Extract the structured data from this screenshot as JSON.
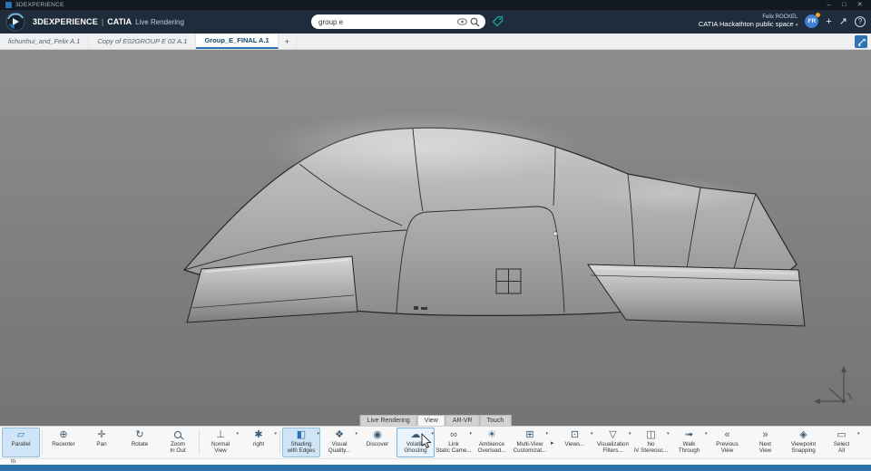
{
  "titlebar": {
    "app_label": "3DEXPERIENCE",
    "minimize": "–",
    "maximize": "□",
    "close": "✕"
  },
  "header": {
    "brand": "3DEXPERIENCE",
    "divider": "|",
    "app": "CATIA",
    "module": "Live Rendering",
    "search_value": "group e",
    "user_name": "Felix ROCKEL",
    "workspace": "CATIA Hackathton public space",
    "workspace_caret": "▾",
    "avatar": "FR",
    "add_icon": "+",
    "share_icon": "↗",
    "help_icon": "?"
  },
  "tabbar": {
    "tabs": [
      {
        "label": "lichunhui_and_Felix A.1"
      },
      {
        "label": "Copy of E02GROUP E 02 A.1"
      },
      {
        "label": "Group_E_FINAL A.1"
      }
    ],
    "add_tab": "+"
  },
  "viewport": {
    "tabs": [
      {
        "label": "Live Rendering"
      },
      {
        "label": "View"
      },
      {
        "label": "AR-VR"
      },
      {
        "label": "Touch"
      }
    ],
    "active_tab": "View",
    "background_color": "#7f7f7f",
    "model_name": "Group_E_FINAL concept car"
  },
  "toolbar": {
    "caret": "▾",
    "overflow": "▸",
    "selected_color": "#cfe4f6",
    "buttons": [
      {
        "icon": "▱",
        "label": "Parallel"
      },
      {
        "icon": "⊕",
        "label": "Recenter"
      },
      {
        "icon": "✛",
        "label": "Pan"
      },
      {
        "icon": "↻",
        "label": "Rotate"
      },
      {
        "icon": "",
        "label": "Zoom\nIn Out"
      },
      {
        "icon": "⊥",
        "label": "Normal\nView"
      },
      {
        "icon": "✱",
        "label": "right"
      },
      {
        "icon": "◧",
        "label": "Shading\nwith Edges"
      },
      {
        "icon": "❖",
        "label": "Visual\nQuality..."
      },
      {
        "icon": "◉",
        "label": "Discover"
      },
      {
        "icon": "☁",
        "label": "Volatile\nGhosting"
      },
      {
        "icon": "∞",
        "label": "Link\nStatic Came..."
      },
      {
        "icon": "☀",
        "label": "Ambience\nOverload..."
      },
      {
        "icon": "⊞",
        "label": "Multi-View\nCustomizat..."
      },
      {
        "icon": "⊡",
        "label": "Views..."
      },
      {
        "icon": "▽",
        "label": "Visualization\nFilters..."
      },
      {
        "icon": "◫",
        "label": "No\niV Stereosc..."
      },
      {
        "icon": "➟",
        "label": "Walk\nThrough"
      },
      {
        "icon": "«",
        "label": "Previous\nView"
      },
      {
        "icon": "»",
        "label": "Next\nView"
      },
      {
        "icon": "◈",
        "label": "Viewpoint\nSnapping"
      },
      {
        "icon": "▭",
        "label": "Select\nAll"
      }
    ]
  },
  "statusrow": {
    "partial_label": "In"
  }
}
